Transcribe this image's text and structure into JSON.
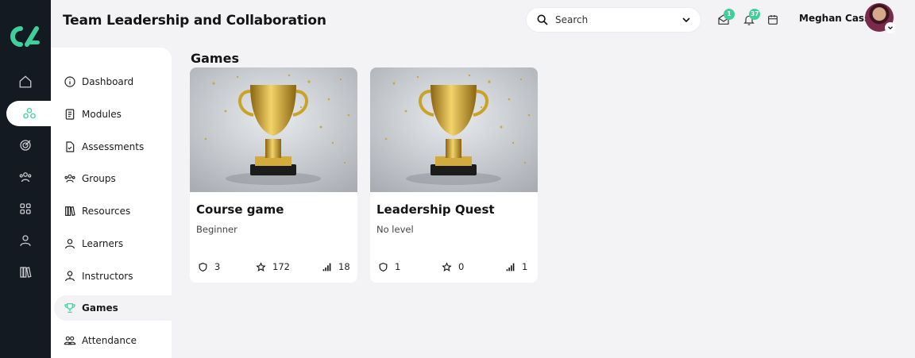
{
  "header": {
    "title": "Team Leadership and Collaboration",
    "search_placeholder": "Search",
    "messages_count": "1",
    "notifications_count": "37",
    "user_name": "Meghan Cass"
  },
  "rail": {
    "icons": [
      "home-icon",
      "modules-hub-icon",
      "target-icon",
      "users-icon",
      "apps-grid-icon",
      "user-icon",
      "library-icon"
    ],
    "active_index": 1
  },
  "sidebar": {
    "items": [
      {
        "label": "Dashboard",
        "icon": "info-icon"
      },
      {
        "label": "Modules",
        "icon": "book-icon"
      },
      {
        "label": "Assessments",
        "icon": "document-check-icon"
      },
      {
        "label": "Groups",
        "icon": "group-icon"
      },
      {
        "label": "Resources",
        "icon": "resources-icon"
      },
      {
        "label": "Learners",
        "icon": "learner-icon"
      },
      {
        "label": "Instructors",
        "icon": "instructor-icon"
      },
      {
        "label": "Games",
        "icon": "trophy-icon"
      },
      {
        "label": "Attendance",
        "icon": "attendance-icon"
      }
    ],
    "active": "Games"
  },
  "main": {
    "section_title": "Games",
    "cards": [
      {
        "title": "Course game",
        "level": "Beginner",
        "shields": "3",
        "stars": "172",
        "levels": "18"
      },
      {
        "title": "Leadership Quest",
        "level": "No level",
        "shields": "1",
        "stars": "0",
        "levels": "1"
      }
    ]
  },
  "colors": {
    "rail_bg": "#141a22",
    "accent": "#3ecf9a",
    "page_bg": "#f3f3f5"
  }
}
